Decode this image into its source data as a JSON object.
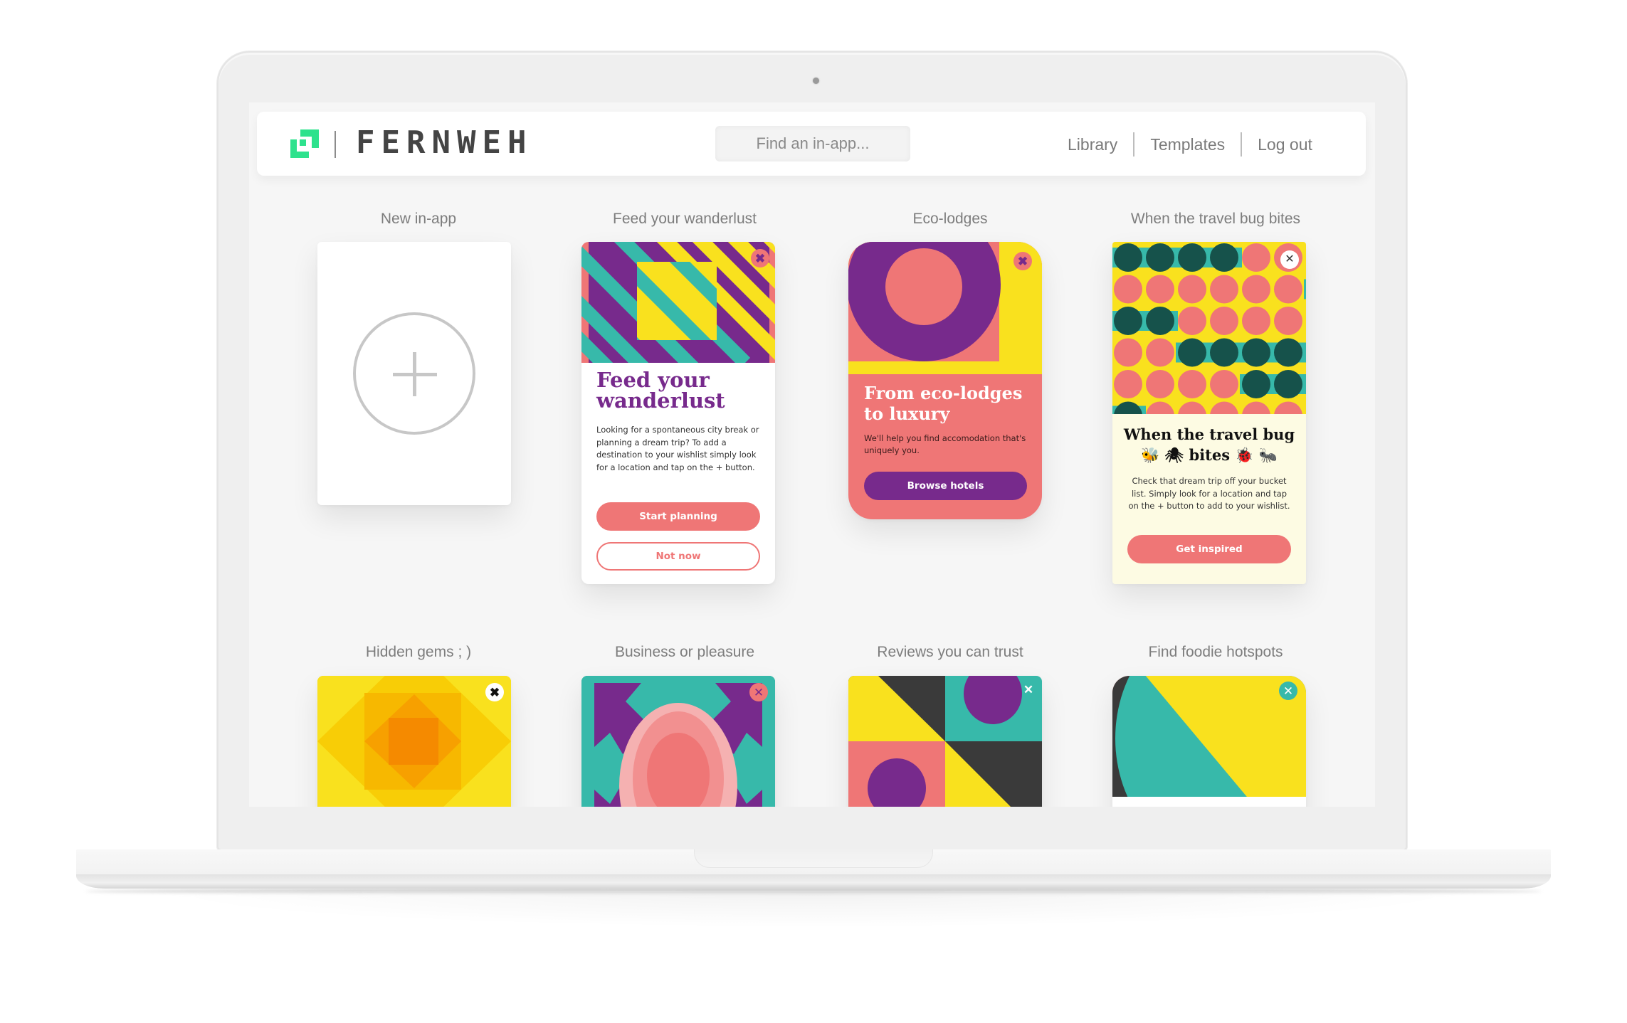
{
  "app": {
    "brand": "FERNWEH",
    "brand_color": "#2ee28d"
  },
  "header": {
    "search": {
      "placeholder": "Find an in-app...",
      "value": ""
    },
    "nav": [
      {
        "label": "Library"
      },
      {
        "label": "Templates"
      },
      {
        "label": "Log out"
      }
    ]
  },
  "palette": {
    "purple": "#772a8c",
    "yellow": "#f9e11e",
    "teal": "#37b9aa",
    "coral": "#ef7676",
    "dark_teal": "#16524b",
    "charcoal": "#3a3a3a",
    "cream": "#fdfbe3"
  },
  "cards": [
    {
      "label": "New in-app",
      "icon": "plus-circle-icon"
    },
    {
      "label": "Feed your wanderlust",
      "title": "Feed your wanderlust",
      "body": "Looking for a spontaneous city break or planning a dream trip? To add a destination to your wishlist simply look for a location and tap on the + button.",
      "primary_button": "Start planning",
      "secondary_button": "Not now",
      "close": "✖"
    },
    {
      "label": "Eco-lodges",
      "title": "From eco-lodges to luxury",
      "body": "We'll help you find accomodation that's uniquely you.",
      "primary_button": "Browse hotels",
      "close": "✖"
    },
    {
      "label": "When the travel bug bites",
      "title_line1": "When the travel bug",
      "title_line2": "🐝 🕷 bites 🐞 🐜",
      "body": "Check that dream trip off your bucket list. Simply look for a location and tap on the + button to add to your wishlist.",
      "primary_button": "Get inspired",
      "close": "✕"
    },
    {
      "label": "Hidden gems ; )",
      "close": "✖"
    },
    {
      "label": "Business or pleasure",
      "close": "✕"
    },
    {
      "label": "Reviews you can trust",
      "close": "✕"
    },
    {
      "label": "Find foodie hotspots",
      "close": "✕"
    }
  ]
}
